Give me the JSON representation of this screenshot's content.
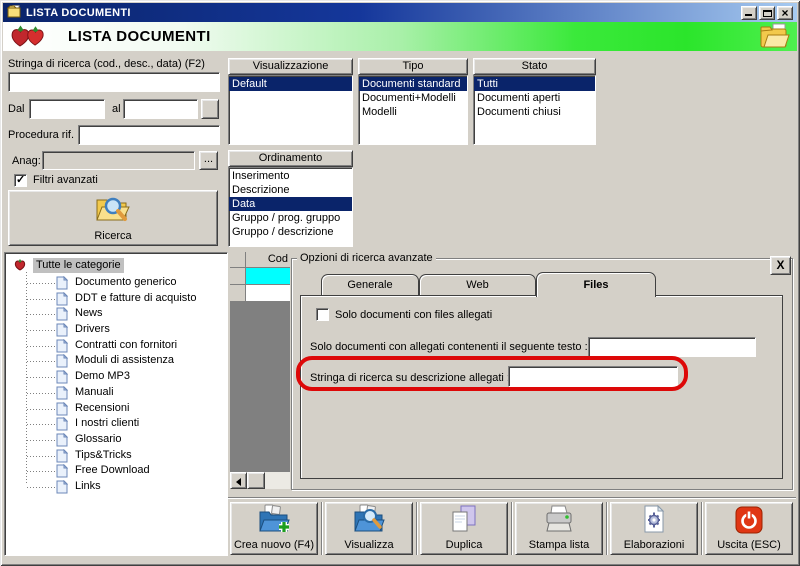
{
  "window": {
    "title": "LISTA DOCUMENTI"
  },
  "header": {
    "title": "LISTA DOCUMENTI"
  },
  "search": {
    "query_label": "Stringa di ricerca (cod., desc., data) (F2)",
    "query_value": "",
    "dal_label": "Dal",
    "dal_value": "",
    "al_label": "al",
    "al_value": "",
    "procedura_label": "Procedura rif.",
    "procedura_value": "",
    "anag_label": "Anag:",
    "anag_value": "",
    "anag_browse_label": "...",
    "filtri_avanzati_label": "Filtri avanzati",
    "filtri_avanzati_checked": true,
    "ricerca_button_label": "Ricerca"
  },
  "listboxes": {
    "visualizzazione": {
      "title": "Visualizzazione",
      "items": [
        {
          "label": "Default",
          "selected": true
        }
      ]
    },
    "tipo": {
      "title": "Tipo",
      "items": [
        {
          "label": "Documenti standard",
          "selected": true
        },
        {
          "label": "Documenti+Modelli"
        },
        {
          "label": "Modelli"
        }
      ]
    },
    "stato": {
      "title": "Stato",
      "items": [
        {
          "label": "Tutti",
          "selected": true
        },
        {
          "label": "Documenti aperti"
        },
        {
          "label": "Documenti chiusi"
        }
      ]
    },
    "ordinamento": {
      "title": "Ordinamento",
      "items": [
        {
          "label": "Inserimento"
        },
        {
          "label": "Descrizione"
        },
        {
          "label": "Data",
          "selected": true
        },
        {
          "label": "Gruppo / prog. gruppo"
        },
        {
          "label": "Gruppo / descrizione"
        }
      ]
    }
  },
  "categories_tree": {
    "root": "Tutte le categorie",
    "items": [
      "Documento generico",
      "DDT e fatture di acquisto",
      "News",
      "Drivers",
      "Contratti con fornitori",
      "Moduli di assistenza",
      "Demo MP3",
      "Manuali",
      "Recensioni",
      "I nostri clienti",
      "Glossario",
      "Tips&Tricks",
      "Free Download",
      "Links"
    ]
  },
  "results_table": {
    "header": "Cod"
  },
  "advanced_options": {
    "title": "Opzioni di ricerca avanzate",
    "close_label": "X",
    "tabs": [
      {
        "label": "Generale"
      },
      {
        "label": "Web"
      },
      {
        "label": "Files",
        "active": true
      }
    ],
    "files_tab": {
      "only_with_files_label": "Solo documenti con files allegati",
      "only_with_files_checked": false,
      "attachment_text_label": "Solo documenti con allegati contenenti il seguente testo :",
      "attachment_text_value": "",
      "attachment_desc_label": "Stringa di ricerca su descrizione allegati :",
      "attachment_desc_value": ""
    }
  },
  "toolbar": {
    "buttons": [
      {
        "label": "Crea nuovo (F4)",
        "icon": "folder-add-icon"
      },
      {
        "label": "Visualizza",
        "icon": "folder-search-icon"
      },
      {
        "label": "Duplica",
        "icon": "copy-icon"
      },
      {
        "label": "Stampa lista",
        "icon": "printer-icon"
      },
      {
        "label": "Elaborazioni",
        "icon": "process-icon"
      },
      {
        "label": "Uscita (ESC)",
        "icon": "power-icon"
      }
    ]
  },
  "colors": {
    "titlebar_start": "#0A246A",
    "titlebar_end": "#A6CAF0",
    "header_green": "#2BE52B",
    "selection_navy": "#0A246A",
    "row_highlight_cyan": "#00FFFF",
    "annotation_red": "#DD0808",
    "window_bg": "#D4D0C8",
    "table_fill_gray": "#808080"
  }
}
